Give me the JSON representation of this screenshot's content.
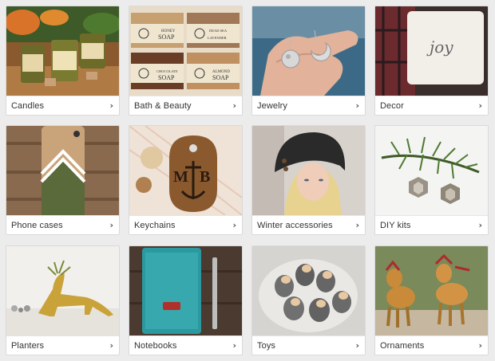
{
  "categories": [
    {
      "label": "Candles",
      "icon": "chevron-right-icon"
    },
    {
      "label": "Bath & Beauty",
      "icon": "chevron-right-icon"
    },
    {
      "label": "Jewelry",
      "icon": "chevron-right-icon"
    },
    {
      "label": "Decor",
      "icon": "chevron-right-icon"
    },
    {
      "label": "Phone cases",
      "icon": "chevron-right-icon"
    },
    {
      "label": "Keychains",
      "icon": "chevron-right-icon"
    },
    {
      "label": "Winter accessories",
      "icon": "chevron-right-icon"
    },
    {
      "label": "DIY kits",
      "icon": "chevron-right-icon"
    },
    {
      "label": "Planters",
      "icon": "chevron-right-icon"
    },
    {
      "label": "Notebooks",
      "icon": "chevron-right-icon"
    },
    {
      "label": "Toys",
      "icon": "chevron-right-icon"
    },
    {
      "label": "Ornaments",
      "icon": "chevron-right-icon"
    }
  ],
  "image_text": {
    "soap_labels": [
      "HONEY SOAP",
      "DEAD SEA SALT AND LAVENDER",
      "CHOCOLATE SOAP",
      "ALMOND SOAP"
    ],
    "pillow_text": "joy",
    "keychain_letters": "M B"
  },
  "chevron_glyph": "›"
}
